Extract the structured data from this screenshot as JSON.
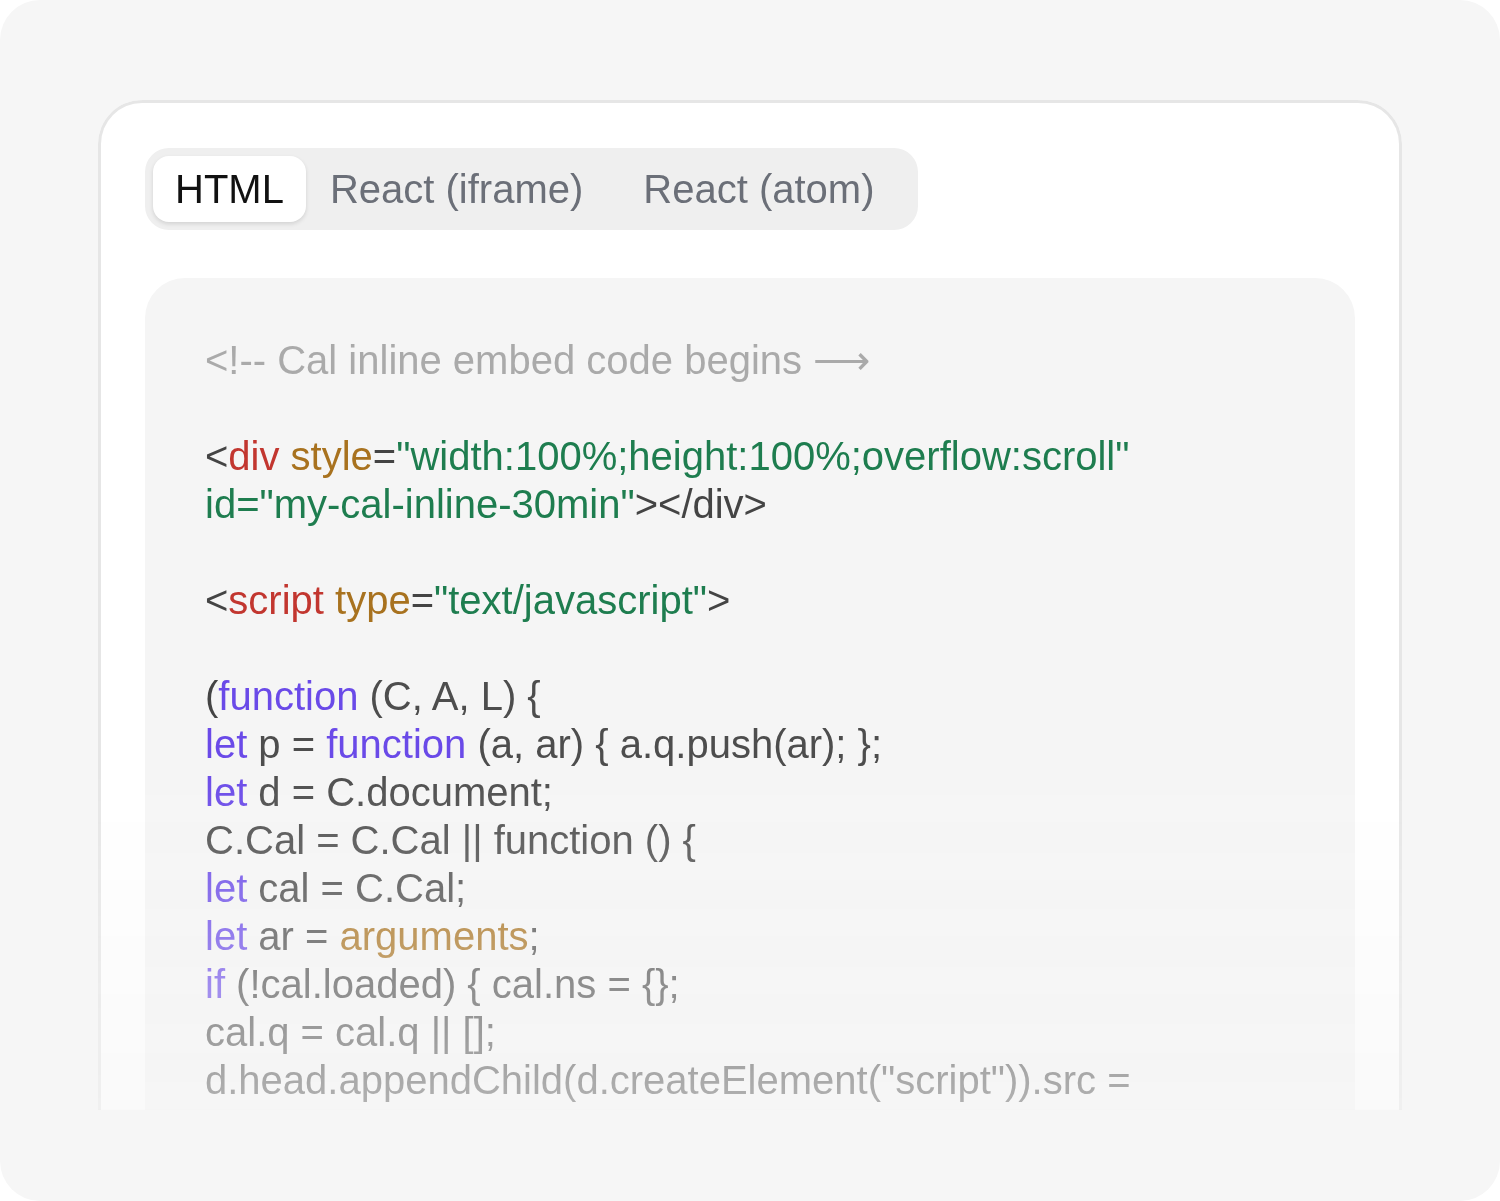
{
  "tabs": [
    {
      "label": "HTML",
      "selected": true
    },
    {
      "label": "React (iframe)",
      "selected": false
    },
    {
      "label": "React (atom)",
      "selected": false
    }
  ],
  "code": {
    "blocks": [
      {
        "lines": [
          {
            "tokens": [
              {
                "kind": "comment",
                "text": "<!-- Cal inline embed code begins ⟶"
              }
            ]
          }
        ]
      },
      {
        "lines": [
          {
            "tokens": [
              {
                "kind": "punct",
                "text": "<"
              },
              {
                "kind": "tag",
                "text": "div"
              },
              {
                "kind": "attr",
                "text": " style"
              },
              {
                "kind": "punct",
                "text": "="
              },
              {
                "kind": "string",
                "text": "\"width:100%;height:100%;overflow:scroll\""
              }
            ]
          },
          {
            "tokens": [
              {
                "kind": "string",
                "text": "id=\"my-cal-inline-30min\""
              },
              {
                "kind": "punct",
                "text": "></div>"
              }
            ]
          }
        ]
      },
      {
        "lines": [
          {
            "tokens": [
              {
                "kind": "punct",
                "text": "<"
              },
              {
                "kind": "tag",
                "text": "script"
              },
              {
                "kind": "attr",
                "text": " type"
              },
              {
                "kind": "punct",
                "text": "="
              },
              {
                "kind": "string",
                "text": "\"text/javascript\""
              },
              {
                "kind": "punct",
                "text": ">"
              }
            ]
          }
        ]
      },
      {
        "lines": [
          {
            "tokens": [
              {
                "kind": "punct",
                "text": "("
              },
              {
                "kind": "keyword",
                "text": "function"
              },
              {
                "kind": "plain",
                "text": " (C, A, L) {"
              }
            ]
          },
          {
            "tokens": [
              {
                "kind": "keyword",
                "text": "let"
              },
              {
                "kind": "plain",
                "text": " p = "
              },
              {
                "kind": "keyword",
                "text": "function"
              },
              {
                "kind": "plain",
                "text": " (a, ar) { a.q.push(ar); };"
              }
            ]
          },
          {
            "tokens": [
              {
                "kind": "keyword",
                "text": "let"
              },
              {
                "kind": "plain",
                "text": " d = C.document;"
              }
            ]
          },
          {
            "tokens": [
              {
                "kind": "plain",
                "text": "C.Cal = C.Cal || function () {"
              }
            ]
          },
          {
            "tokens": [
              {
                "kind": "keyword",
                "text": "let"
              },
              {
                "kind": "plain",
                "text": " cal = C.Cal;"
              }
            ]
          },
          {
            "tokens": [
              {
                "kind": "keyword",
                "text": "let"
              },
              {
                "kind": "plain",
                "text": " ar = "
              },
              {
                "kind": "attr",
                "text": "arguments"
              },
              {
                "kind": "plain",
                "text": ";"
              }
            ]
          },
          {
            "tokens": [
              {
                "kind": "keyword",
                "text": "if"
              },
              {
                "kind": "plain",
                "text": " (!cal.loaded) { cal.ns = {};"
              }
            ]
          },
          {
            "tokens": [
              {
                "kind": "plain",
                "text": "cal.q = cal.q || [];"
              }
            ]
          },
          {
            "tokens": [
              {
                "kind": "plain",
                "text": "d.head.appendChild(d.createElement(\"script\")).src ="
              }
            ]
          }
        ]
      }
    ]
  }
}
